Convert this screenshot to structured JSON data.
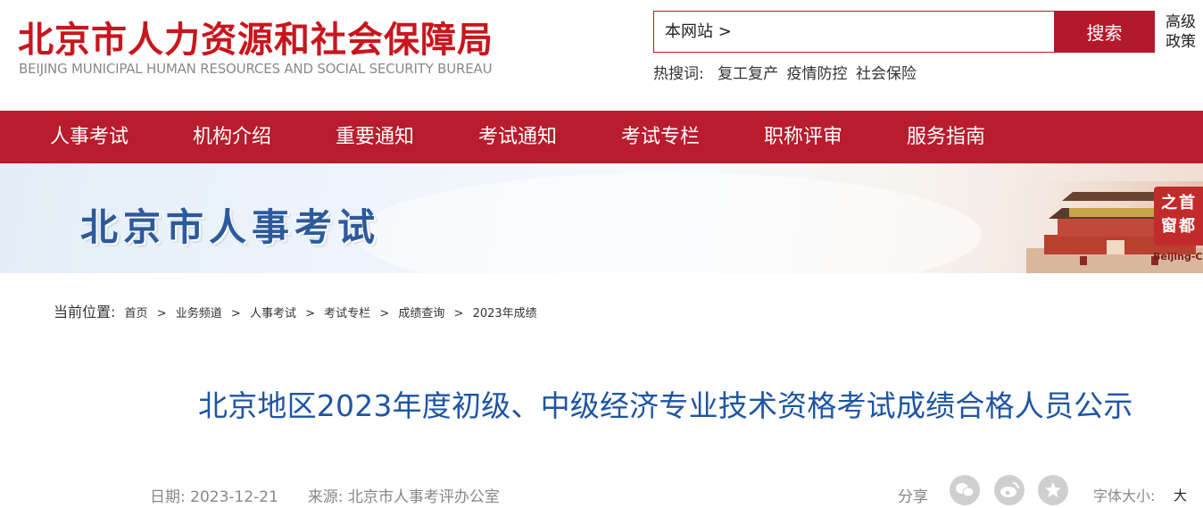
{
  "header": {
    "logo_cn": "北京市人力资源和社会保障局",
    "logo_en": "BEIJING MUNICIPAL HUMAN RESOURCES AND SOCIAL SECURITY BUREAU",
    "brand_color": "#c8161d"
  },
  "search": {
    "scope": "本网站 >",
    "value": "",
    "button": "搜索",
    "hot_label": "热搜词:",
    "hot_terms": [
      "复工复产",
      "疫情防控",
      "社会保险"
    ],
    "advanced_1": "高级",
    "advanced_2": "政策"
  },
  "nav": {
    "color": "#b81c2d",
    "items": [
      "人事考试",
      "机构介绍",
      "重要通知",
      "考试通知",
      "考试专栏",
      "职称评审",
      "服务指南"
    ]
  },
  "banner": {
    "title": "北京市人事考试",
    "seal_text": "之首\n窗都",
    "caption": "Beijing-Ch"
  },
  "breadcrumb": {
    "label": "当前位置:",
    "items": [
      "首页",
      "业务频道",
      "人事考试",
      "考试专栏",
      "成绩查询",
      "2023年成绩"
    ],
    "separator": ">"
  },
  "article": {
    "title": "北京地区2023年度初级、中级经济专业技术资格考试成绩合格人员公示",
    "date_label": "日期:",
    "date": "2023-12-21",
    "source_label": "来源:",
    "source": "北京市人事考评办公室"
  },
  "toolbar": {
    "share_label": "分享",
    "share_icons": [
      "wechat-icon",
      "weibo-icon",
      "favorite-icon"
    ],
    "font_size_label": "字体大小:",
    "font_size_big": "大"
  }
}
